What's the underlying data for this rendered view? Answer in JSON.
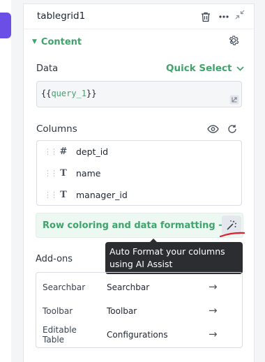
{
  "panel": {
    "title": "tablegrid1",
    "section_label": "Content"
  },
  "data_field": {
    "label": "Data",
    "quick_select_label": "Quick Select",
    "open_braces": "{{",
    "query_name": "query_1",
    "close_braces": "}}"
  },
  "columns": {
    "label": "Columns",
    "items": [
      {
        "type_glyph": "#",
        "name": "dept_id"
      },
      {
        "type_glyph": "T",
        "name": "name"
      },
      {
        "type_glyph": "T",
        "name": "manager_id"
      }
    ]
  },
  "row_coloring": {
    "label": "Row coloring and data formatting →"
  },
  "tooltip": {
    "text": "Auto Format your columns using AI Assist"
  },
  "addons": {
    "label": "Add-ons",
    "items": [
      {
        "name": "Searchbar",
        "value": "Searchbar"
      },
      {
        "name": "Toolbar",
        "value": "Toolbar"
      },
      {
        "name": "Editable Table",
        "value": "Configurations"
      }
    ],
    "arrow_glyph": "→"
  },
  "colors": {
    "accent_green": "#3fa36b",
    "brand_purple": "#6b4ee6",
    "tooltip_bg": "#2b2d31",
    "annotation_red": "#e0202a"
  },
  "icons": [
    "trash-icon",
    "more-icon",
    "collapse-icon",
    "caret-down-icon",
    "gear-icon",
    "chevron-down-icon",
    "expand-icon",
    "eye-icon",
    "refresh-icon",
    "drag-handle-icon",
    "hash-icon",
    "text-type-icon",
    "magic-wand-icon",
    "arrow-right-icon",
    "plus-icon"
  ]
}
